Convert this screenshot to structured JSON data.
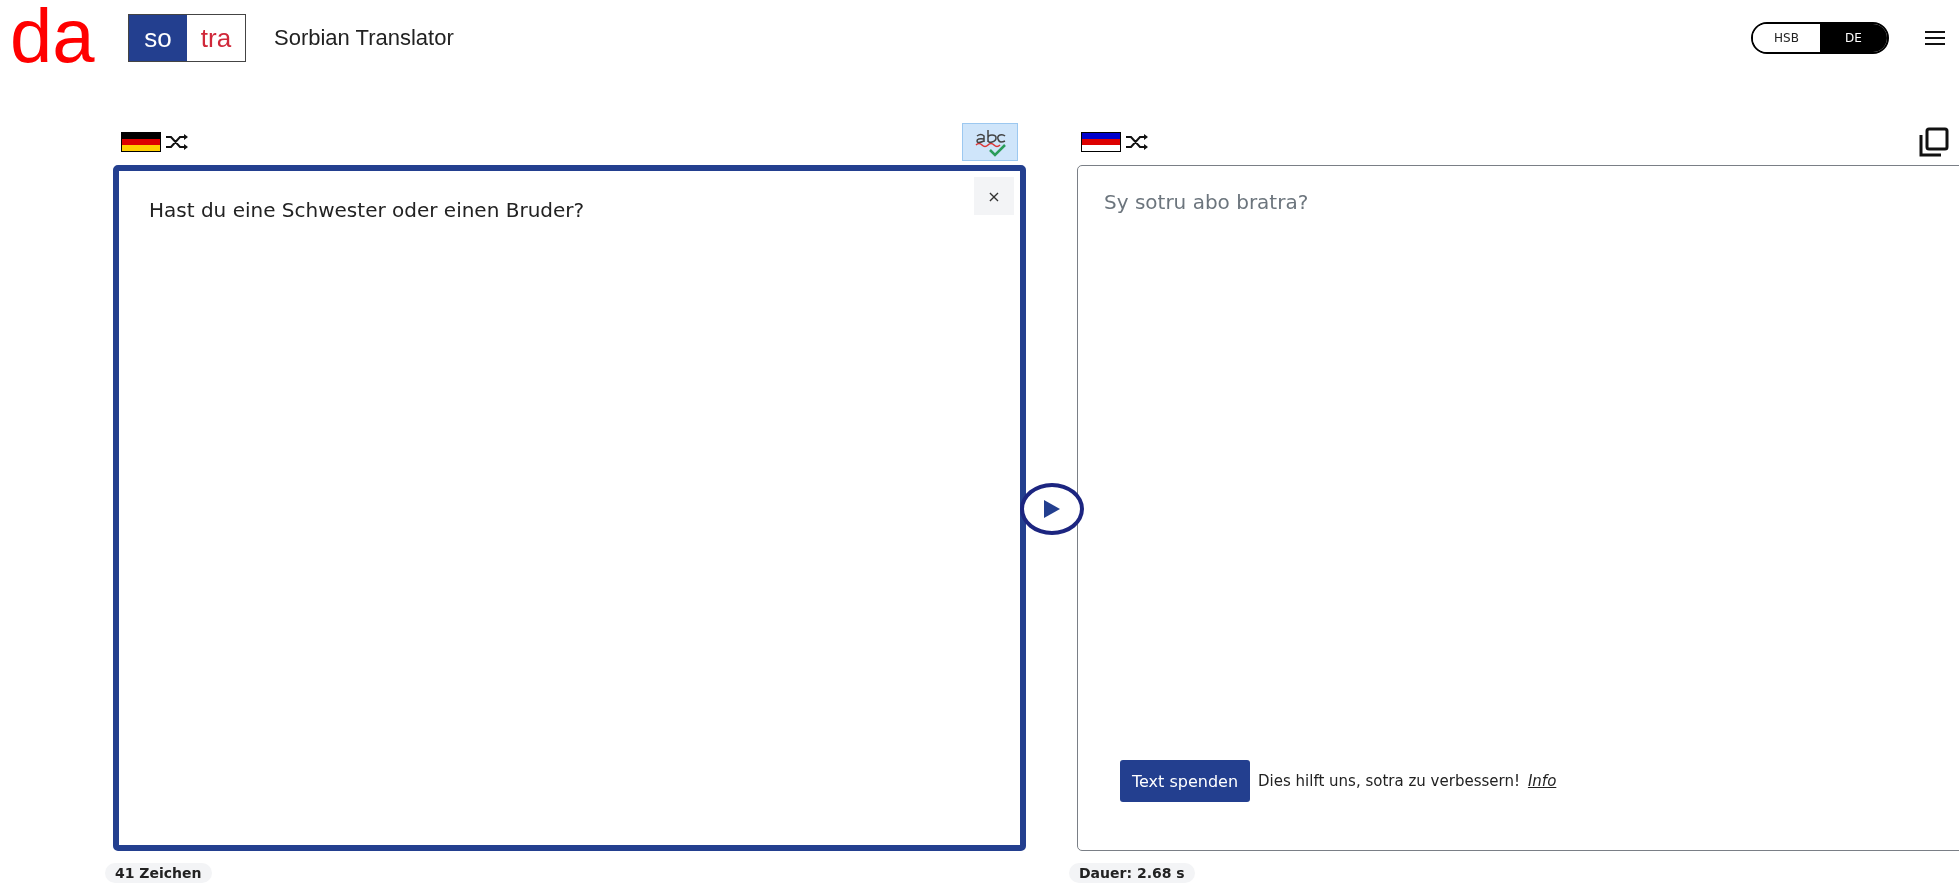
{
  "header": {
    "logo_text": "da",
    "brand": {
      "left": "so",
      "right": "tra"
    },
    "title": "Sorbian Translator",
    "language_toggle": [
      {
        "label": "HSB",
        "selected": false
      },
      {
        "label": "DE",
        "selected": true
      }
    ]
  },
  "source": {
    "text": "Hast du eine Schwester oder einen Bruder?",
    "close": "×",
    "spellcheck_active": true,
    "char_count": "41 Zeichen"
  },
  "target": {
    "text": "Sy sotru abo bratra?",
    "donate_button": "Text spenden",
    "donate_note": "Dies hilft uns, sotra zu verbessern!",
    "info_link": "Info",
    "duration": "Dauer: 2.68 s"
  }
}
